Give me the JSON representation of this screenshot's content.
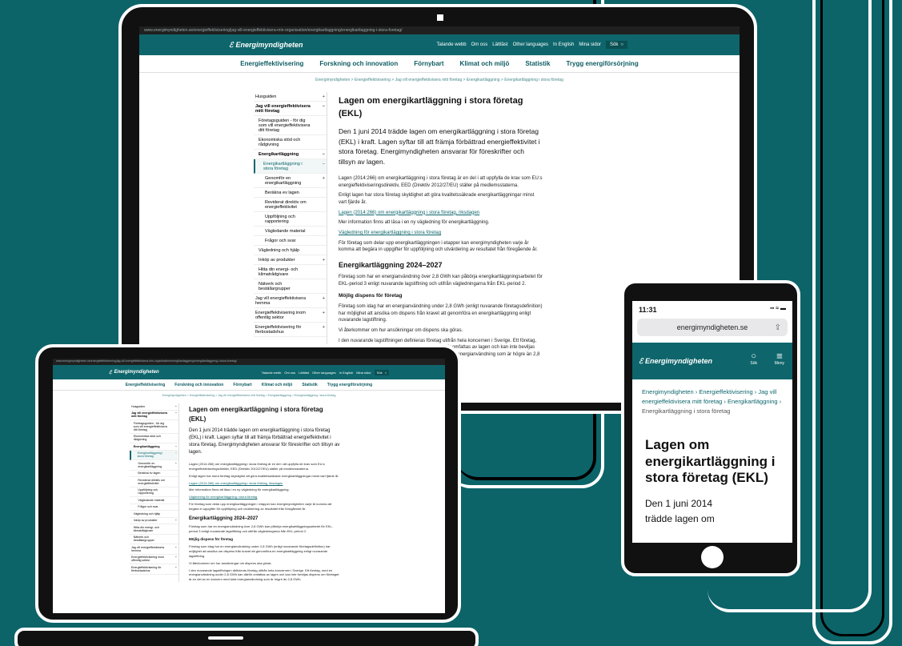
{
  "colors": {
    "teal": "#0c6469",
    "header": "#0e666c",
    "device": "#111111"
  },
  "browser": {
    "url": "www.energimyndigheten.se/energieffektivisering/jag-vill-energieffektivisera-min-organisation/energikartlaggning/energikartlaggning-i-stora-foretag/"
  },
  "site": {
    "logo_text": "Energimyndigheten",
    "top_links": [
      "Talande webb",
      "Om oss",
      "Lättläst",
      "Other languages",
      "In English",
      "Mina sidor"
    ],
    "search_label": "Sök",
    "nav": [
      "Energieffektivisering",
      "Forskning och innovation",
      "Förnybart",
      "Klimat och miljö",
      "Statistik",
      "Trygg energiförsörjning"
    ],
    "breadcrumb": "Energimyndigheten > Energieffektivisering > Jag vill energieffektivisera mitt företag > Energikartläggning > Energikartläggning i stora företag"
  },
  "sidebar": [
    {
      "label": "Husguiden",
      "icon": "+",
      "level": 0
    },
    {
      "label": "Jag vill energieffektivisera mitt företag",
      "icon": "−",
      "level": 0,
      "bold": true
    },
    {
      "label": "Företagsguiden - för dig som vill energieffektivisera ditt företag",
      "icon": "",
      "level": 1
    },
    {
      "label": "Ekonomiska stöd och rådgivning",
      "icon": "",
      "level": 1
    },
    {
      "label": "Energikartläggning",
      "icon": "−",
      "level": 1,
      "bold": true
    },
    {
      "label": "Energikartläggning i stora företag",
      "icon": "−",
      "level": 2,
      "active": true
    },
    {
      "label": "Genomför en energikartläggning",
      "icon": "+",
      "level": 3
    },
    {
      "label": "Beräkna ev lagen",
      "icon": "",
      "level": 3
    },
    {
      "label": "Reviderat direktiv om energieffektivitet",
      "icon": "",
      "level": 3
    },
    {
      "label": "Uppföljning och rapportering",
      "icon": "",
      "level": 3
    },
    {
      "label": "Vägledande material",
      "icon": "",
      "level": 3
    },
    {
      "label": "Frågor och svar",
      "icon": "",
      "level": 3
    },
    {
      "label": "Vägledning och hjälp",
      "icon": "",
      "level": 1
    },
    {
      "label": "Inköp av produkter",
      "icon": "+",
      "level": 1
    },
    {
      "label": "Hitta din energi- och klimatrådgivare",
      "icon": "",
      "level": 1
    },
    {
      "label": "Nätverk och beställargrupper",
      "icon": "",
      "level": 1
    },
    {
      "label": "Jag vill energieffektivisera hemma",
      "icon": "+",
      "level": 0
    },
    {
      "label": "Energieffektivisering inom offentlig sektor",
      "icon": "+",
      "level": 0
    },
    {
      "label": "Energieffektivisering för flerbostadshus",
      "icon": "+",
      "level": 0
    }
  ],
  "article": {
    "title": "Lagen om energikartläggning i stora företag (EKL)",
    "lead": "Den 1 juni 2014 trädde lagen om energikartläggning i stora företag (EKL) i kraft. Lagen syftar till att främja förbättrad energieffektivitet i stora företag. Energimyndigheten ansvarar för föreskrifter och tillsyn av lagen.",
    "p1": "Lagen (2014:266) om energikartläggning i stora företag är en del i att uppfylla de krav som EU:s energieffektiviseringsdirektiv, EED (Direktiv 2012/27/EU) ställer på medlemsstaterna.",
    "p2": "Enligt lagen har stora företag skyldighet att göra kvalitetssäkrade energikartläggningar minst vart fjärde år.",
    "link1": "Lagen (2014:266) om energikartläggning i stora företag, riksdagen",
    "p3": "Mer information finns att läsa i en ny vägledning för energikartläggning.",
    "link2": "Vägledning för energikartläggning i stora företag",
    "p4": "För företag som delar upp energikartläggningen i etapper kan energimyndigheten varje år komma att begära in uppgifter för uppföljning och utvärdering av resultatet från föregående år.",
    "h2": "Energikartläggning 2024–2027",
    "p5": "Företag som har en energianvändning över 2,8 GWh kan påbörja energikartläggningsarbetet för EKL-period 3 enligt nuvarande lagstiftning och utifrån vägledningarna från EKL-period 2.",
    "h3": "Möjlig dispens för företag",
    "p6": "Företag som idag har en energianvändning under 2,8 GWh (enligt nuvarande företagsdefinition) har möjlighet att ansöka om dispens från kravet att genomföra en energikartläggning enligt nuvarande lagstiftning.",
    "p7": "Vi återkommer om hur ansökningar om dispens ska göras.",
    "p8": "I den nuvarande lagstiftningen definieras företag utifrån hela koncernen i Sverige. Ett företag, med en energianvändning under 2,8 GWh kan därför omfattas av lagen och kan inte beviljas dispens om företaget är en del av en koncern med total energianvändning som är högre än 2,8 GWh."
  },
  "phone": {
    "time": "11:31",
    "address": "energimyndigheten.se",
    "search_label": "Sök",
    "menu_label": "Meny",
    "breadcrumb_links": [
      "Energimyndigheten",
      "Energieffektivisering",
      "Jag vill energieffektivisera mitt företag",
      "Energikartläggning"
    ],
    "breadcrumb_current": "Energikartläggning i stora företag",
    "title": "Lagen om energikartläggning i stora företag (EKL)",
    "lead": "Den 1 juni 2014 trädde lagen om"
  }
}
